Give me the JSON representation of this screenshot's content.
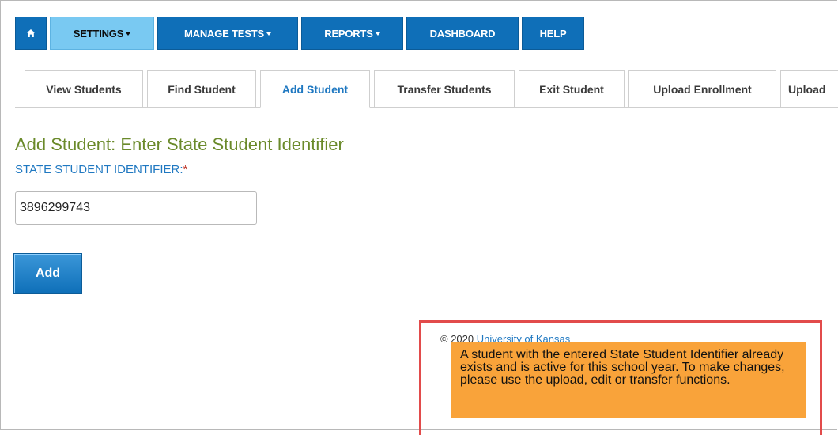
{
  "nav": {
    "home_icon": "home-icon",
    "settings": "SETTINGS",
    "manage_tests": "MANAGE TESTS",
    "reports": "REPORTS",
    "dashboard": "DASHBOARD",
    "help": "HELP",
    "colors": {
      "primary": "#0f6fb8",
      "active": "#79c9f2"
    }
  },
  "tabs": [
    {
      "label": "View Students"
    },
    {
      "label": "Find Student"
    },
    {
      "label": "Add Student"
    },
    {
      "label": "Transfer Students"
    },
    {
      "label": "Exit Student"
    },
    {
      "label": "Upload Enrollment"
    },
    {
      "label": "Upload"
    }
  ],
  "form": {
    "title": "Add Student: Enter State Student Identifier",
    "label": "STATE STUDENT IDENTIFIER:",
    "required_mark": "*",
    "ssid_value": "3896299743",
    "add_button": "Add"
  },
  "footer": {
    "copyright": "© 2020",
    "link": "University of Kansas"
  },
  "message": {
    "text": "A student with the entered State Student Identifier already exists and is active for this school year. To make changes, please use the upload, edit or transfer functions.",
    "color": "#f9a33a",
    "highlight_color": "#e24b4b"
  }
}
